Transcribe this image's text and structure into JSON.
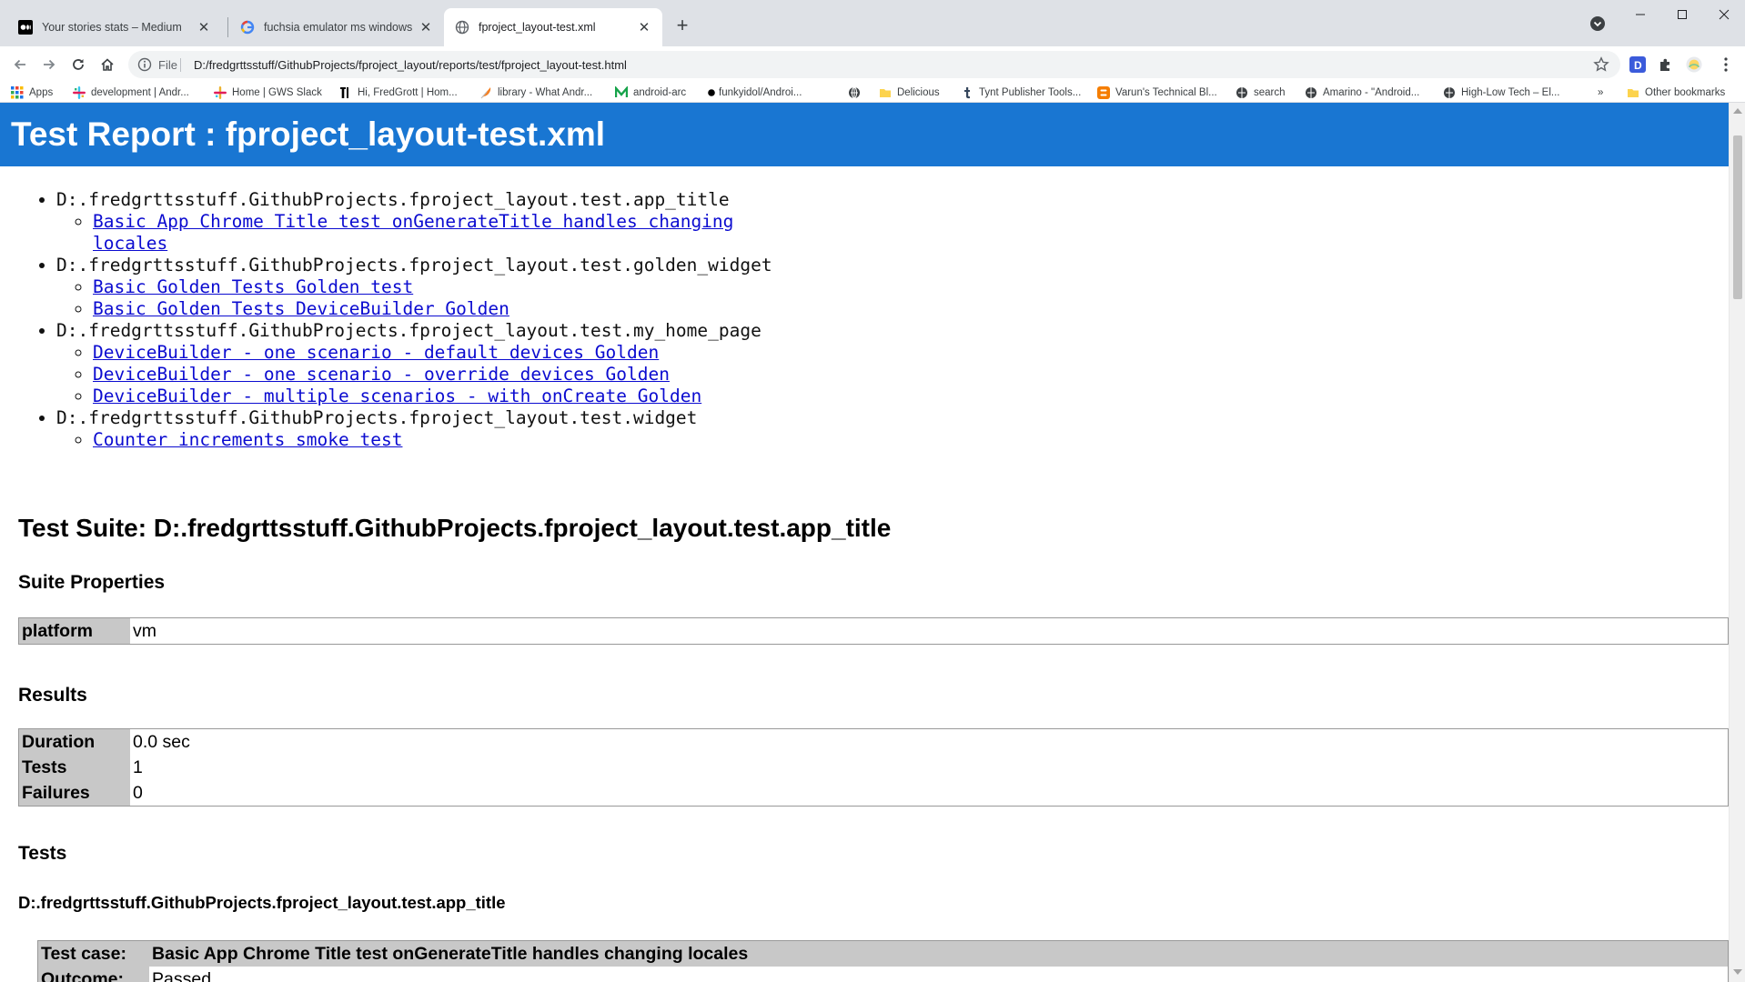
{
  "browser": {
    "tabs": [
      {
        "title": "Your stories stats – Medium",
        "favicon": "medium-icon"
      },
      {
        "title": "fuchsia emulator ms windows gi...",
        "favicon": "google-icon"
      },
      {
        "title": "fproject_layout-test.xml",
        "favicon": "globe-icon"
      }
    ],
    "scheme_label": "File",
    "url": "D:/fredgrttsstuff/GithubProjects/fproject_layout/reports/test/fproject_layout-test.html",
    "bookmarks": [
      {
        "label": "Apps",
        "icon": "apps-grid-icon"
      },
      {
        "label": "development | Andr...",
        "icon": "slack-icon"
      },
      {
        "label": "Home | GWS Slack",
        "icon": "slack-icon"
      },
      {
        "label": "Hi, FredGrott | Hom...",
        "icon": "medium-icon"
      },
      {
        "label": "library - What Andr...",
        "icon": "feather-icon"
      },
      {
        "label": "android-arc",
        "icon": "m-icon"
      },
      {
        "label": "funkyidol/Androi...",
        "icon": "github-icon"
      },
      {
        "label": "",
        "icon": "globe-icon"
      },
      {
        "label": "Delicious",
        "icon": "folder-icon"
      },
      {
        "label": "Tynt Publisher Tools...",
        "icon": "tumblr-icon"
      },
      {
        "label": "Varun's Technical Bl...",
        "icon": "blogger-icon"
      },
      {
        "label": "search",
        "icon": "globe-icon"
      },
      {
        "label": "Amarino - \"Android...",
        "icon": "globe-icon"
      },
      {
        "label": "High-Low Tech – El...",
        "icon": "globe-icon"
      }
    ],
    "overflow_label": "»",
    "other_bookmarks": "Other bookmarks",
    "colors": {
      "tabstrip": "#dee1e6",
      "header": "#1976d2",
      "link": "#0b0bd0"
    }
  },
  "page": {
    "title": "Test Report : fproject_layout-test.xml",
    "toc": [
      {
        "group": "D:.fredgrttsstuff.GithubProjects.fproject_layout.test.app_title",
        "items": [
          {
            "line1": "Basic App Chrome Title test onGenerateTitle handles changing",
            "line2": "locales"
          }
        ]
      },
      {
        "group": "D:.fredgrttsstuff.GithubProjects.fproject_layout.test.golden_widget",
        "items": [
          {
            "line1": "Basic Golden Tests Golden test"
          },
          {
            "line1": "Basic Golden Tests DeviceBuilder Golden"
          }
        ]
      },
      {
        "group": "D:.fredgrttsstuff.GithubProjects.fproject_layout.test.my_home_page",
        "items": [
          {
            "line1": "DeviceBuilder - one scenario - default devices Golden"
          },
          {
            "line1": "DeviceBuilder - one scenario - override devices Golden"
          },
          {
            "line1": "DeviceBuilder - multiple scenarios - with onCreate Golden"
          }
        ]
      },
      {
        "group": "D:.fredgrttsstuff.GithubProjects.fproject_layout.test.widget",
        "items": [
          {
            "line1": "Counter increments smoke test"
          }
        ]
      }
    ],
    "suite_heading": "Test Suite: D:.fredgrttsstuff.GithubProjects.fproject_layout.test.app_title",
    "suite_properties_heading": "Suite Properties",
    "properties": {
      "label": "platform",
      "value": "vm"
    },
    "results_heading": "Results",
    "results": [
      {
        "label": "Duration",
        "value": "0.0 sec"
      },
      {
        "label": "Tests",
        "value": "1"
      },
      {
        "label": "Failures",
        "value": "0"
      }
    ],
    "tests_heading": "Tests",
    "tests_group_heading": "D:.fredgrttsstuff.GithubProjects.fproject_layout.test.app_title",
    "test_case": {
      "case_label": "Test case:",
      "case_value": "Basic App Chrome Title test onGenerateTitle handles changing locales",
      "outcome_label": "Outcome:",
      "outcome_value": "Passed"
    }
  }
}
